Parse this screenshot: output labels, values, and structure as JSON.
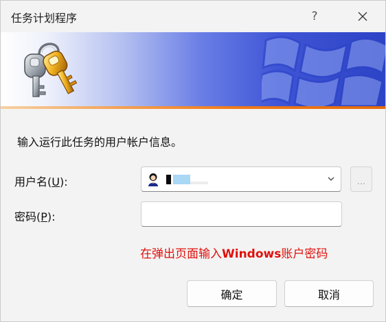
{
  "window": {
    "title": "任务计划程序",
    "help_label": "?",
    "close_icon": "close-icon"
  },
  "banner": {
    "icon": "keys-icon",
    "watermark": "windows-logo",
    "colors": {
      "gradient_start": "#ffffff",
      "gradient_end": "#2d43c5",
      "stripe": "#ef7a1a"
    }
  },
  "form": {
    "info_text": "输入运行此任务的用户帐户信息。",
    "user_label": "用户名(U):",
    "user_label_prefix": "用户名(",
    "user_label_key": "U",
    "user_label_suffix": "):",
    "password_label_prefix": "密码(",
    "password_label_key": "P",
    "password_label_suffix": "):",
    "browse_label": "...",
    "password_value": ""
  },
  "annotation": {
    "prefix": "在弹出页面输入",
    "bold": "Windows",
    "suffix": "账户密码",
    "color": "#e0100b"
  },
  "buttons": {
    "ok": "确定",
    "cancel": "取消"
  }
}
